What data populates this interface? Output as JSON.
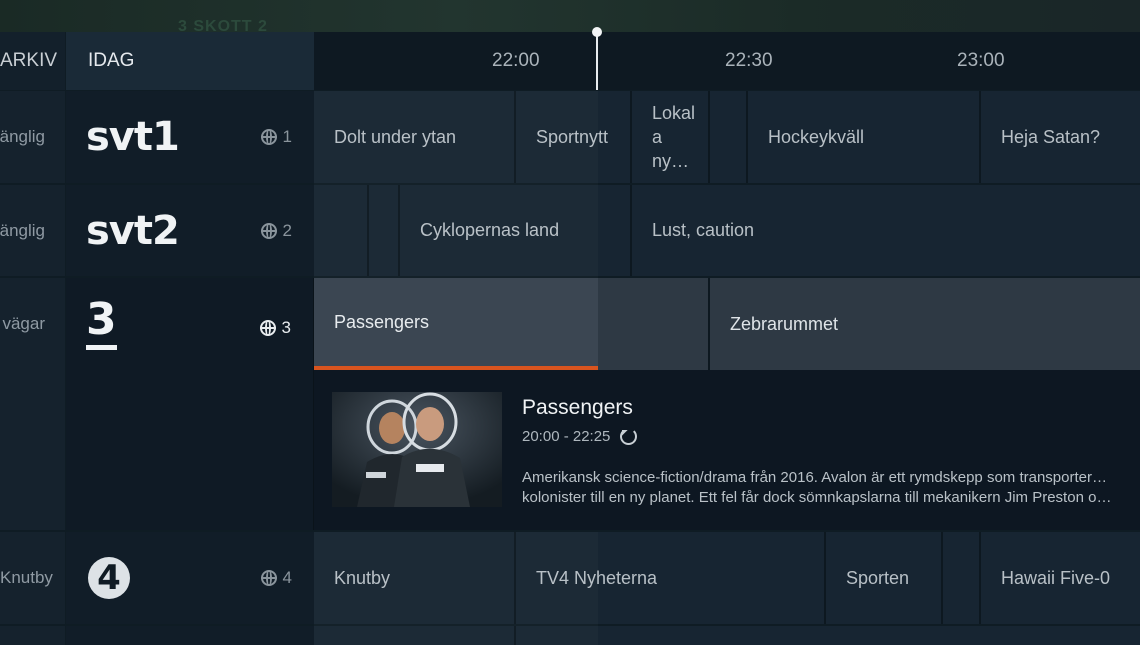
{
  "header": {
    "archive_label": "ARKIV",
    "today_label": "IDAG",
    "times": [
      "22:00",
      "22:30",
      "23:00"
    ]
  },
  "background": {
    "text": "3 SKOTT 2"
  },
  "channels": [
    {
      "left_text": "gänglig",
      "logo": "svt1",
      "number": "1",
      "programs": [
        "Dolt under ytan",
        "Sportnytt",
        "Lokal a ny…",
        "",
        "Hockeykväll",
        "Heja Satan?"
      ]
    },
    {
      "left_text": "gänglig",
      "logo": "svt2",
      "number": "2",
      "programs": [
        "",
        "",
        "Cyklopernas land",
        "Lust, caution"
      ]
    },
    {
      "left_text": "a vägar",
      "logo": "3",
      "number": "3",
      "programs": [
        "Passengers",
        "",
        "Zebrarummet"
      ]
    },
    {
      "left_text": "Knutby",
      "logo": "4",
      "number": "4",
      "programs": [
        "Knutby",
        "TV4 Nyheterna",
        "Sporten",
        "",
        "Hawaii Five-0"
      ]
    }
  ],
  "detail": {
    "title": "Passengers",
    "time": "20:00 - 22:25",
    "description_line1": "Amerikansk science-fiction/drama från 2016. Avalon är ett rymdskepp som transporterar tusentals",
    "description_line2": "kolonister till en ny planet. Ett fel får dock sömnkapslarna till mekanikern Jim Preston och förfat…",
    "progress": 1.0
  },
  "colors": {
    "accent": "#d9541e",
    "background": "#0f1c24",
    "selected_program": "#3b4652"
  }
}
